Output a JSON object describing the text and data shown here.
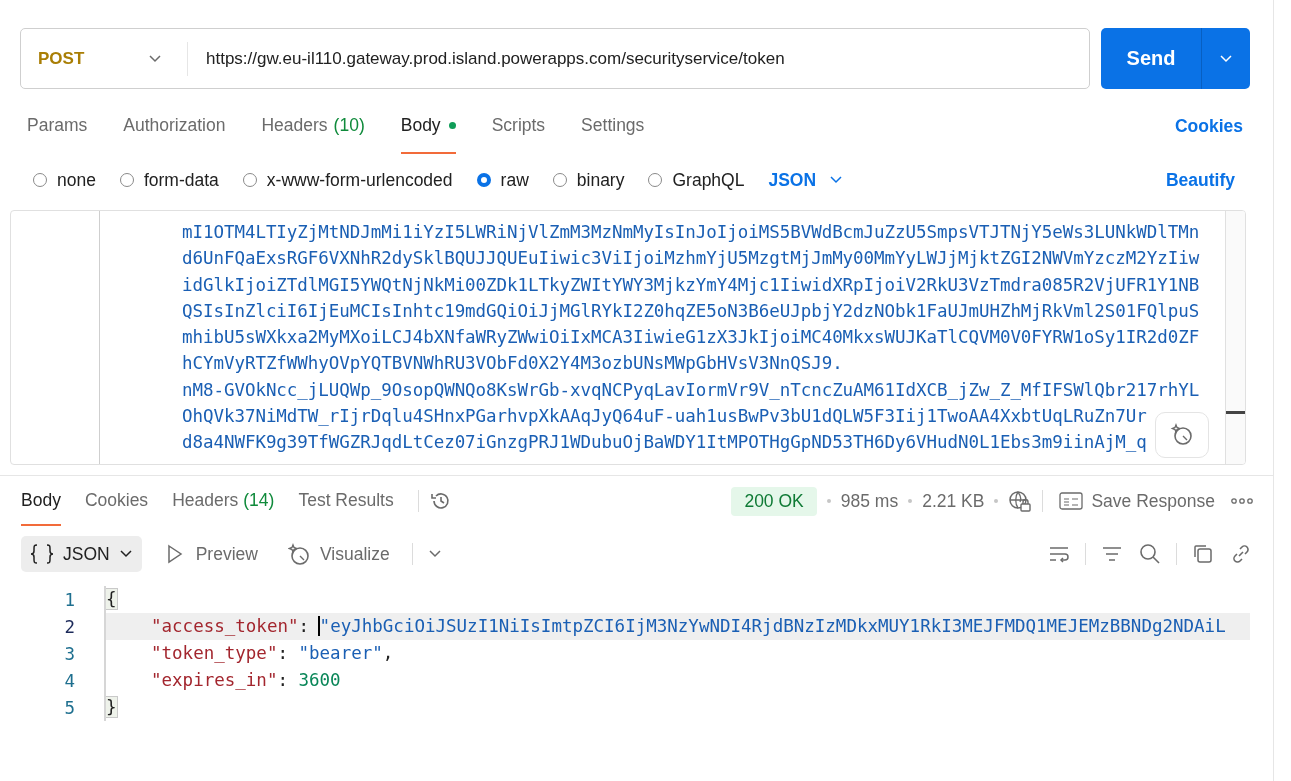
{
  "request": {
    "method": "POST",
    "url": "https://gw.eu-il110.gateway.prod.island.powerapps.com/securityservice/token",
    "send": "Send"
  },
  "request_tabs": [
    {
      "label": "Params",
      "dot": false,
      "selected": false
    },
    {
      "label": "Authorization",
      "dot": false,
      "selected": false
    },
    {
      "label": "Headers",
      "count": "(10)",
      "dot": false,
      "selected": false
    },
    {
      "label": "Body",
      "dot": true,
      "selected": true
    },
    {
      "label": "Scripts",
      "dot": false,
      "selected": false
    },
    {
      "label": "Settings",
      "dot": false,
      "selected": false
    }
  ],
  "cookies_link": "Cookies",
  "body_types": [
    {
      "label": "none",
      "selected": false
    },
    {
      "label": "form-data",
      "selected": false
    },
    {
      "label": "x-www-form-urlencoded",
      "selected": false
    },
    {
      "label": "raw",
      "selected": true
    },
    {
      "label": "binary",
      "selected": false
    },
    {
      "label": "GraphQL",
      "selected": false
    }
  ],
  "body_format": "JSON",
  "beautify": "Beautify",
  "request_body_lines": [
    "mI1OTM4LTIyZjMtNDJmMi1iYzI5LWRiNjVlZmM3MzNmMyIsInJoIjoiMS5BVWdBcmJuZzU5SmpsVTJTNjY5eWs3LUNkWDlTMn",
    "d6UnFQaExsRGF6VXNhR2dySklBQUJJQUEuIiwic3ViIjoiMzhmYjU5MzgtMjJmMy00MmYyLWJjMjktZGI2NWVmYzczM2YzIiw",
    "idGlkIjoiZTdlMGI5YWQtNjNkMi00ZDk1LTkyZWItYWY3MjkzYmY4Mjc1IiwidXRpIjoiV2RkU3VzTmdra085R2VjUFR1Y1NB",
    "QSIsInZlciI6IjEuMCIsInhtc19mdGQiOiJjMGlRYkI2Z0hqZE5oN3B6eUJpbjY2dzNObk1FaUJmUHZhMjRkVml2S01FQlpuS",
    "mhibU5sWXkxa2MyMXoiLCJ4bXNfaWRyZWwiOiIxMCA3IiwieG1zX3JkIjoiMC40MkxsWUJKaTlCQVM0V0FYRW1oSy1IR2d0ZF",
    "hCYmVyRTZfWWhyOVpYQTBVNWhRU3VObFd0X2Y4M3ozbUNsMWpGbHVsV3NnQSJ9.",
    "nM8-GVOkNcc_jLUQWp_9OsopQWNQo8KsWrGb-xvqNCPyqLavIormVr9V_nTcncZuAM61IdXCB_jZw_Z_MfIFSWlQbr217rhYL",
    "OhQVk37NiMdTW_rIjrDqlu4SHnxPGarhvpXkAAqJyQ64uF-uah1usBwPv3bU1dQLW5F3Iij1TwoAA4XxbtUqLRuZn7Ur",
    "d8a4NWFK9g39TfWGZRJqdLtCez07iGnzgPRJ1WDubuOjBaWDY1ItMPOTHgGpND53TH6Dy6VHudN0L1Ebs3m9iinAjM_q"
  ],
  "response_tabs": [
    {
      "label": "Body",
      "selected": true
    },
    {
      "label": "Cookies",
      "selected": false
    },
    {
      "label": "Headers",
      "count": "(14)",
      "selected": false
    },
    {
      "label": "Test Results",
      "selected": false
    }
  ],
  "status": "200 OK",
  "time": "985 ms",
  "size": "2.21 KB",
  "save_response": "Save Response",
  "view_modes": [
    {
      "kind": "format",
      "label": "JSON",
      "selected": true
    },
    {
      "kind": "preview",
      "label": "Preview",
      "selected": false
    },
    {
      "kind": "visualize",
      "label": "Visualize",
      "selected": false
    }
  ],
  "response_lines": [
    {
      "number": "1",
      "active": false,
      "tokens": [
        {
          "kind": "brace",
          "text": "{"
        }
      ]
    },
    {
      "number": "2",
      "active": true,
      "tokens": [
        {
          "kind": "key",
          "text": "\"access_token\""
        },
        {
          "kind": "punct",
          "text": ": "
        },
        {
          "kind": "string",
          "text": "\"eyJhbGciOiJSUzI1NiIsImtpZCI6IjM3NzYwNDI4RjdBNzIzMDkxMUY1RkI3MEJFMDQ1MEJEMzBBNDg2NDAiL"
        }
      ]
    },
    {
      "number": "3",
      "active": false,
      "tokens": [
        {
          "kind": "key",
          "text": "\"token_type\""
        },
        {
          "kind": "punct",
          "text": ": "
        },
        {
          "kind": "string",
          "text": "\"bearer\""
        },
        {
          "kind": "punct",
          "text": ","
        }
      ]
    },
    {
      "number": "4",
      "active": false,
      "tokens": [
        {
          "kind": "key",
          "text": "\"expires_in\""
        },
        {
          "kind": "punct",
          "text": ": "
        },
        {
          "kind": "number",
          "text": "3600"
        }
      ]
    },
    {
      "number": "5",
      "active": false,
      "tokens": [
        {
          "kind": "brace",
          "text": "}"
        }
      ]
    }
  ]
}
